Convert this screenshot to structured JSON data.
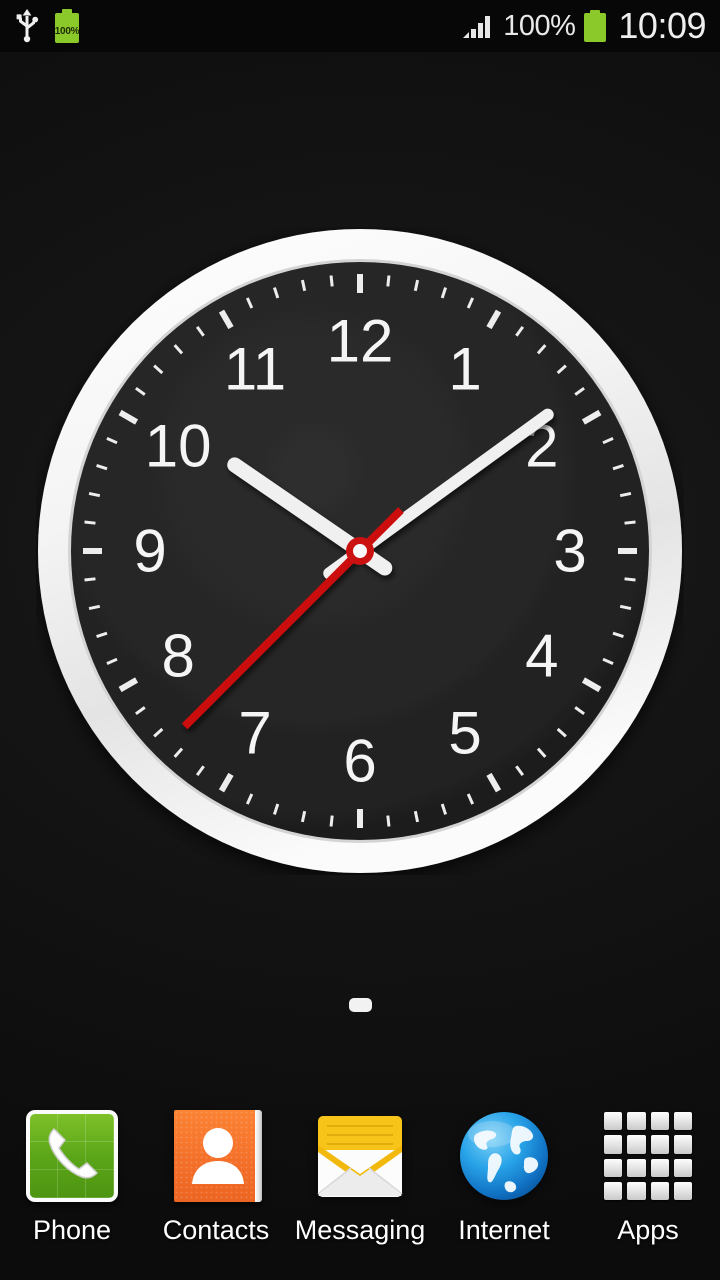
{
  "status_bar": {
    "usb_icon": "usb-icon",
    "left_battery_icon": "battery-charging-icon",
    "left_battery_percent": "100%",
    "signal_icon": "signal-bars-icon",
    "signal_bars": 4,
    "battery_percent": "100%",
    "right_battery_icon": "battery-icon",
    "time": "10:09"
  },
  "clock_widget": {
    "name": "analog-clock-widget",
    "numerals": [
      "1",
      "2",
      "3",
      "4",
      "5",
      "6",
      "7",
      "8",
      "9",
      "10",
      "11",
      "12"
    ],
    "hour_value": 10,
    "minute_value": 9,
    "second_value": 45,
    "hour_angle_deg": 304.5,
    "minute_angle_deg": 54,
    "second_angle_deg": 225,
    "bezel_color": "#f2f2f2",
    "face_color": "#232323",
    "numeral_color": "#f5f5f5",
    "hand_color": "#f0f0f0",
    "second_hand_color": "#cc1111",
    "hub_color": "#cc1111"
  },
  "page_indicator": {
    "name": "home-screen-page-indicator",
    "pages": 1,
    "active_index": 0
  },
  "dock": {
    "items": [
      {
        "label": "Phone",
        "icon": "phone-handset-icon"
      },
      {
        "label": "Contacts",
        "icon": "contacts-person-icon"
      },
      {
        "label": "Messaging",
        "icon": "envelope-icon"
      },
      {
        "label": "Internet",
        "icon": "globe-icon"
      },
      {
        "label": "Apps",
        "icon": "apps-grid-icon"
      }
    ]
  },
  "colors": {
    "background": "#141414",
    "battery_green": "#8bc829",
    "phone_green": "#5aa518",
    "contacts_orange": "#f4702a",
    "messaging_yellow": "#f7c51a",
    "internet_blue": "#1b8fd8",
    "accent_red": "#cc1111"
  }
}
